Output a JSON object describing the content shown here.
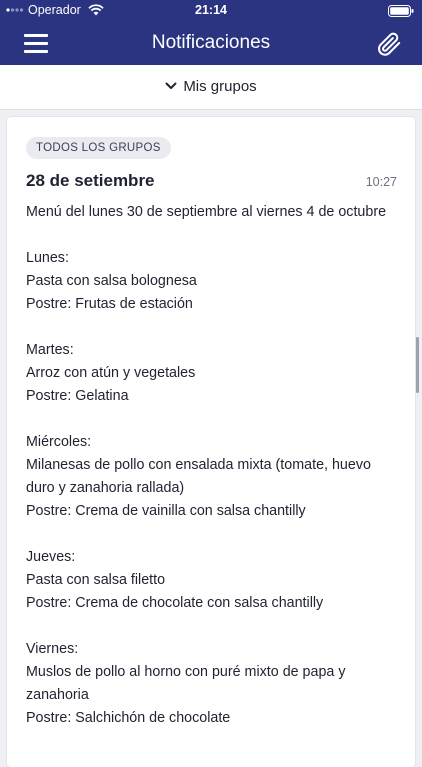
{
  "status_bar": {
    "carrier": "Operador",
    "time": "21:14"
  },
  "header": {
    "title": "Notificaciones",
    "menu_icon": "hamburger-menu-icon",
    "attachment_icon": "paperclip-icon",
    "background_color": "#2b3480"
  },
  "groups_filter": {
    "label": "Mis grupos",
    "icon": "chevron-down-icon"
  },
  "notification": {
    "badge": "TODOS LOS GRUPOS",
    "date": "28 de setiembre",
    "time": "10:27",
    "paragraphs": [
      [
        "Menú del lunes 30 de septiembre al viernes 4 de octubre"
      ],
      [
        "Lunes:",
        "Pasta con salsa bolognesa",
        "Postre: Frutas de estación"
      ],
      [
        "Martes:",
        "Arroz con atún y vegetales",
        "Postre: Gelatina"
      ],
      [
        "Miércoles:",
        "Milanesas de pollo con ensalada mixta (tomate, huevo duro y zanahoria rallada)",
        "Postre: Crema de vainilla con salsa chantilly"
      ],
      [
        "Jueves:",
        "Pasta con salsa filetto",
        "Postre: Crema de chocolate con salsa chantilly"
      ],
      [
        "Viernes:",
        "Muslos de pollo al horno con puré mixto de papa y zanahoria",
        "Postre: Salchichón de chocolate"
      ]
    ]
  }
}
